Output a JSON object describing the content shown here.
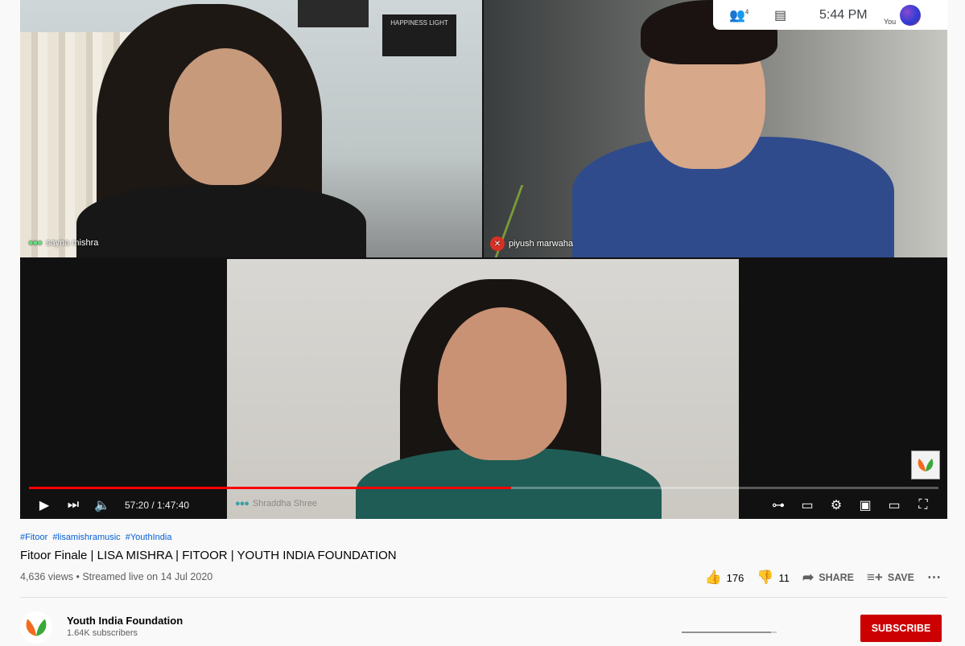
{
  "meet": {
    "participants_count": "4",
    "time": "5:44 PM",
    "you_label": "You"
  },
  "tiles": [
    {
      "name": "sayna mishra"
    },
    {
      "name": "piyush marwaha"
    },
    {
      "name": "Shraddha Shree"
    }
  ],
  "poster_text": "HAPPINESS LIGHT",
  "player": {
    "time": "57:20 / 1:47:40",
    "progress_fraction": 0.53
  },
  "video": {
    "hashtags": [
      "#Fitoor",
      "#lisamishramusic",
      "#YouthIndia"
    ],
    "title": "Fitoor Finale | LISA MISHRA | FITOOR | YOUTH INDIA FOUNDATION",
    "views": "4,636 views • Streamed live on 14 Jul 2020",
    "likes": "176",
    "dislikes": "11",
    "share_label": "SHARE",
    "save_label": "SAVE",
    "like_fraction": 0.94
  },
  "channel": {
    "name": "Youth India Foundation",
    "subscribers": "1.64K subscribers",
    "subscribe_label": "SUBSCRIBE"
  },
  "colors": {
    "progress": "#ff0000",
    "subscribe": "#cc0000",
    "link": "#065fd4"
  }
}
